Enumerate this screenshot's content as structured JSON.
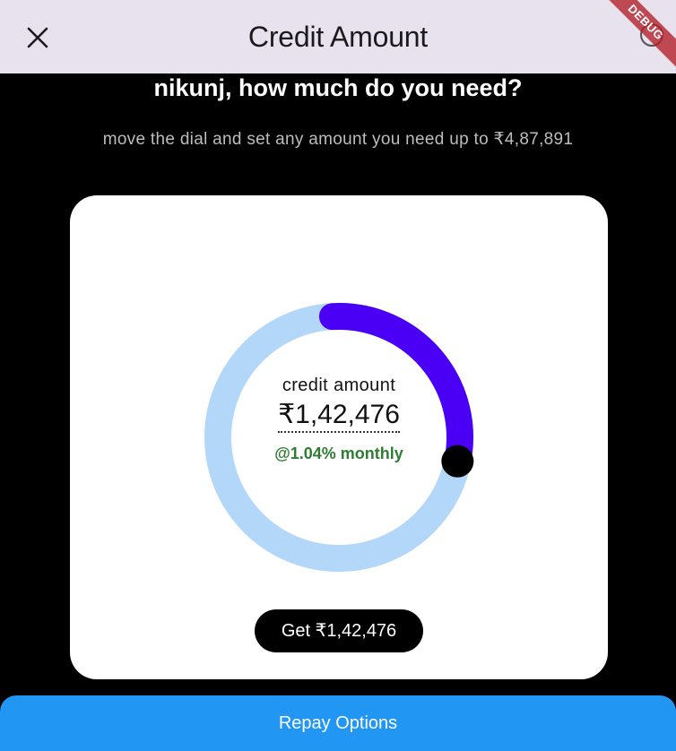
{
  "appbar": {
    "title": "Credit Amount",
    "close_icon": "close-icon",
    "debug_label": "DEBUG"
  },
  "prompt": {
    "heading": "nikunj, how much do you need?",
    "subheading": "move the dial and set any amount you need up to ₹4,87,891"
  },
  "dial": {
    "label": "credit amount",
    "amount": "₹1,42,476",
    "rate": "@1.04% monthly",
    "progress_fraction": 0.29,
    "track_color": "#b3d7f9",
    "fill_color": "#4a00f5",
    "knob_color": "#000000"
  },
  "card": {
    "get_button_label": "Get ₹1,42,476"
  },
  "footer": {
    "repay_label": "Repay Options"
  },
  "colors": {
    "appbar_bg": "#e8e1ee",
    "page_bg": "#000000",
    "rate_green": "#2e7d32",
    "primary_blue": "#2196f3"
  }
}
